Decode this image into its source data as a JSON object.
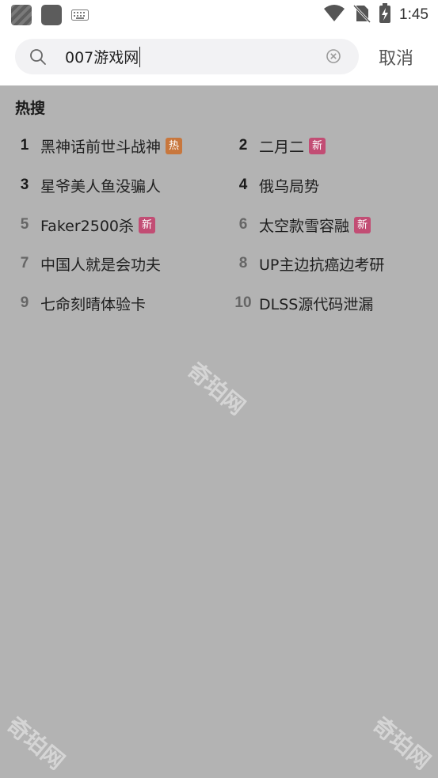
{
  "status_bar": {
    "time": "1:45",
    "icons": [
      "app-icon",
      "app-icon",
      "keyboard-icon",
      "wifi-icon",
      "no-sim-icon",
      "battery-charging-icon"
    ]
  },
  "search": {
    "query": "007游戏网",
    "cancel_label": "取消",
    "icons": [
      "search-icon",
      "clear-icon"
    ]
  },
  "hot_search": {
    "title": "热搜",
    "items": [
      {
        "rank": "1",
        "text": "黑神话前世斗战神",
        "badge": "热"
      },
      {
        "rank": "2",
        "text": "二月二",
        "badge": "新"
      },
      {
        "rank": "3",
        "text": "星爷美人鱼没骗人",
        "badge": ""
      },
      {
        "rank": "4",
        "text": "俄乌局势",
        "badge": ""
      },
      {
        "rank": "5",
        "text": "Faker2500杀",
        "badge": "新"
      },
      {
        "rank": "6",
        "text": "太空款雪容融",
        "badge": "新"
      },
      {
        "rank": "7",
        "text": "中国人就是会功夫",
        "badge": ""
      },
      {
        "rank": "8",
        "text": "UP主边抗癌边考研",
        "badge": ""
      },
      {
        "rank": "9",
        "text": "七命刻晴体验卡",
        "badge": ""
      },
      {
        "rank": "10",
        "text": "DLSS源代码泄漏",
        "badge": ""
      }
    ]
  },
  "watermark": {
    "text": "奇珀网"
  },
  "colors": {
    "overlay": "#b3b3b3",
    "hot_badge": "#c8773d",
    "new_badge": "#c24d74"
  }
}
